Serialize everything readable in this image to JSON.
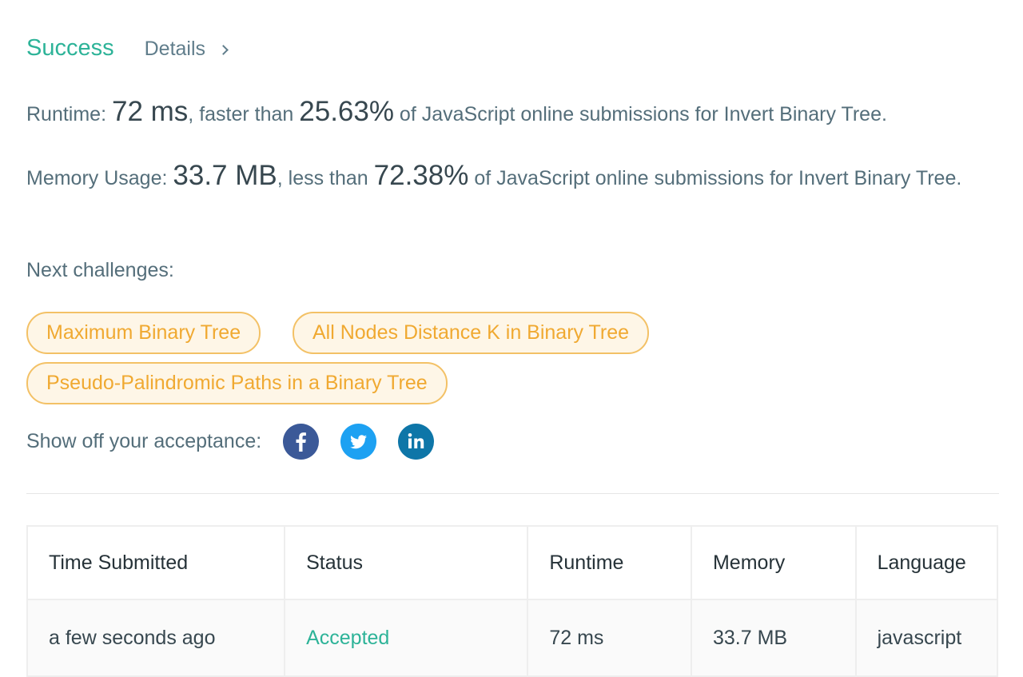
{
  "header": {
    "status": "Success",
    "details_label": "Details"
  },
  "runtime": {
    "label": "Runtime: ",
    "value": "72 ms",
    "comparison": ", faster than ",
    "percent": "25.63%",
    "suffix": " of JavaScript online submissions for Invert Binary Tree."
  },
  "memory": {
    "label": "Memory Usage: ",
    "value": "33.7 MB",
    "comparison": ", less than ",
    "percent": "72.38%",
    "suffix": " of JavaScript online submissions for Invert Binary Tree."
  },
  "next": {
    "label": "Next challenges:",
    "challenges": [
      "Maximum Binary Tree",
      "All Nodes Distance K in Binary Tree",
      "Pseudo-Palindromic Paths in a Binary Tree"
    ]
  },
  "share": {
    "label": "Show off your acceptance:",
    "icons": [
      "facebook-icon",
      "twitter-icon",
      "linkedin-icon"
    ]
  },
  "table": {
    "headers": [
      "Time Submitted",
      "Status",
      "Runtime",
      "Memory",
      "Language"
    ],
    "rows": [
      [
        "a few seconds ago",
        "Accepted",
        "72 ms",
        "33.7 MB",
        "javascript"
      ]
    ]
  },
  "colors": {
    "success": "#2db398",
    "chip_text": "#f0a931",
    "chip_border": "#f3c166",
    "chip_bg": "#fef6e7",
    "facebook": "#3b5998",
    "twitter": "#1da1f2",
    "linkedin": "#0e76a8"
  }
}
